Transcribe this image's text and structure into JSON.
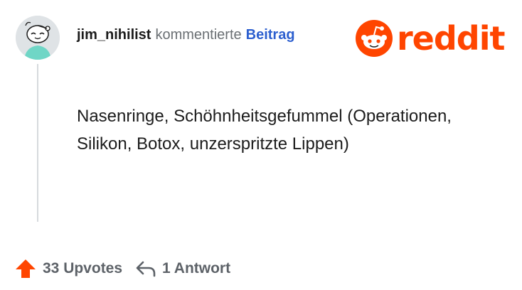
{
  "comment": {
    "username": "jim_nihilist",
    "action": "kommentierte",
    "post_link": "Beitrag",
    "text": "Nasenringe, Schöhnheitsgefummel (Operationen, Silikon, Botox, unzerspritzte Lippen)"
  },
  "brand": {
    "name": "reddit",
    "color": "#ff4500"
  },
  "footer": {
    "upvotes": "33 Upvotes",
    "replies": "1 Antwort"
  },
  "icons": {
    "avatar": "snoo-avatar-icon",
    "upvote": "arrow-up-icon",
    "reply": "reply-arrow-icon",
    "logo": "reddit-snoo-icon"
  },
  "colors": {
    "upvote": "#ff4500",
    "link": "#2c5fcf",
    "muted": "#6a6f73"
  }
}
